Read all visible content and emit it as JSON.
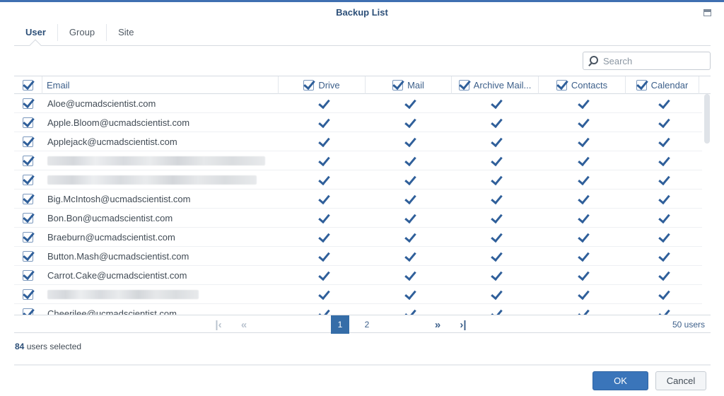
{
  "window": {
    "title": "Backup List"
  },
  "tabs": [
    {
      "label": "User",
      "active": true
    },
    {
      "label": "Group",
      "active": false
    },
    {
      "label": "Site",
      "active": false
    }
  ],
  "search": {
    "placeholder": "Search",
    "value": ""
  },
  "columns": {
    "email": "Email",
    "drive": "Drive",
    "mail": "Mail",
    "archive_mail": "Archive Mail...",
    "contacts": "Contacts",
    "calendar": "Calendar"
  },
  "rows": [
    {
      "email": "Aloe@ucmadscientist.com",
      "redacted": false
    },
    {
      "email": "Apple.Bloom@ucmadscientist.com",
      "redacted": false
    },
    {
      "email": "Applejack@ucmadscientist.com",
      "redacted": false
    },
    {
      "email": "",
      "redacted": true
    },
    {
      "email": "",
      "redacted": true
    },
    {
      "email": "Big.McIntosh@ucmadscientist.com",
      "redacted": false
    },
    {
      "email": "Bon.Bon@ucmadscientist.com",
      "redacted": false
    },
    {
      "email": "Braeburn@ucmadscientist.com",
      "redacted": false
    },
    {
      "email": "Button.Mash@ucmadscientist.com",
      "redacted": false
    },
    {
      "email": "Carrot.Cake@ucmadscientist.com",
      "redacted": false
    },
    {
      "email": "",
      "redacted": true
    },
    {
      "email": "Cheerilee@ucmadscientist.com",
      "redacted": false
    }
  ],
  "pagination": {
    "pages": [
      "1",
      "2"
    ],
    "current_page": "1",
    "first": "|‹",
    "prev": "«",
    "next": "»",
    "last": "›|",
    "total": "50 users"
  },
  "selection": {
    "count": "84",
    "label": "users selected"
  },
  "buttons": {
    "ok": "OK",
    "cancel": "Cancel"
  },
  "colors": {
    "accent": "#356da8",
    "header_text": "#2c4f78",
    "check": "#2f5f9a"
  }
}
